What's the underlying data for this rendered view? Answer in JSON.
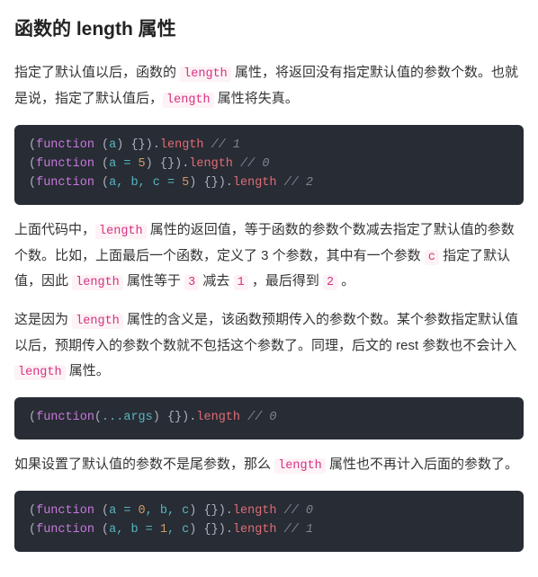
{
  "heading": "函数的 length 属性",
  "para1": {
    "t1": "指定了默认值以后，函数的 ",
    "c1": "length",
    "t2": " 属性，将返回没有指定默认值的参数个数。也就是说，指定了默认值后，",
    "c2": "length",
    "t3": " 属性将失真。"
  },
  "code1": {
    "l1": {
      "open": "(",
      "kw": "function",
      "sp": " ",
      "po": "(",
      "prm": "a",
      "pc": ")",
      "body": " {}",
      "close": ")",
      "dot": ".",
      "prop": "length",
      "csp": " ",
      "cm": "// 1"
    },
    "l2": {
      "open": "(",
      "kw": "function",
      "sp": " ",
      "po": "(",
      "prm": "a ",
      "op": "=",
      "val": " 5",
      "pc": ")",
      "body": " {}",
      "close": ")",
      "dot": ".",
      "prop": "length",
      "csp": " ",
      "cm": "// 0"
    },
    "l3": {
      "open": "(",
      "kw": "function",
      "sp": " ",
      "po": "(",
      "prm": "a, b, c ",
      "op": "=",
      "val": " 5",
      "pc": ")",
      "body": " {}",
      "close": ")",
      "dot": ".",
      "prop": "length",
      "csp": " ",
      "cm": "// 2"
    }
  },
  "para2": {
    "t1": "上面代码中，",
    "c1": "length",
    "t2": " 属性的返回值，等于函数的参数个数减去指定了默认值的参数个数。比如，上面最后一个函数，定义了 3 个参数，其中有一个参数 ",
    "c2": "c",
    "t3": " 指定了默认值，因此 ",
    "c3": "length",
    "t4": " 属性等于 ",
    "c4": "3",
    "t5": " 减去 ",
    "c5": "1",
    "t6": " ，最后得到 ",
    "c6": "2",
    "t7": " 。"
  },
  "para3": {
    "t1": "这是因为 ",
    "c1": "length",
    "t2": " 属性的含义是，该函数预期传入的参数个数。某个参数指定默认值以后，预期传入的参数个数就不包括这个参数了。同理，后文的 rest 参数也不会计入 ",
    "c2": "length",
    "t3": " 属性。"
  },
  "code2": {
    "l1": {
      "open": "(",
      "kw": "function",
      "po": "(",
      "spread": "...",
      "prm": "args",
      "pc": ")",
      "body": " {}",
      "close": ")",
      "dot": ".",
      "prop": "length",
      "csp": " ",
      "cm": "// 0"
    }
  },
  "para4": {
    "t1": "如果设置了默认值的参数不是尾参数，那么 ",
    "c1": "length",
    "t2": " 属性也不再计入后面的参数了。"
  },
  "code3": {
    "l1": {
      "open": "(",
      "kw": "function",
      "sp": " ",
      "po": "(",
      "prm1": "a ",
      "op": "=",
      "val": " 0",
      "rest": ", b, c",
      "pc": ")",
      "body": " {}",
      "close": ")",
      "dot": ".",
      "prop": "length",
      "csp": " ",
      "cm": "// 0"
    },
    "l2": {
      "open": "(",
      "kw": "function",
      "sp": " ",
      "po": "(",
      "prm1": "a, b ",
      "op": "=",
      "val": " 1",
      "rest": ", c",
      "pc": ")",
      "body": " {}",
      "close": ")",
      "dot": ".",
      "prop": "length",
      "csp": " ",
      "cm": "// 1"
    }
  }
}
